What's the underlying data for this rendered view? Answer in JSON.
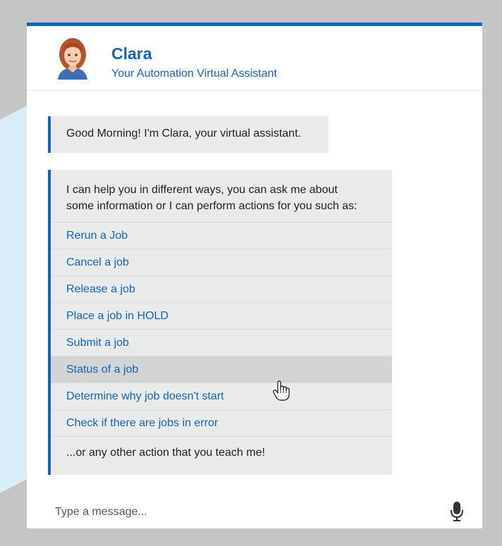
{
  "header": {
    "name": "Clara",
    "subtitle": "Your Automation Virtual Assistant"
  },
  "messages": {
    "greeting": "Good Morning! I'm Clara, your virtual assistant.",
    "intro_line1": "I can help you in different ways, you can ask me about",
    "intro_line2": "some information or I can perform actions for you such as:",
    "options": [
      "Rerun a Job",
      "Cancel a job",
      "Release a job",
      "Place a job in HOLD",
      "Submit a job",
      "Status of a job",
      "Determine why job doesn't start",
      "Check if there are jobs in error"
    ],
    "hovered_option": "Status of a job",
    "footer": "...or any other action that you teach me!"
  },
  "input": {
    "placeholder": "Type a message..."
  },
  "colors": {
    "accent": "#1565b7",
    "bubble": "#e9eaea",
    "hover": "#d3d4d4",
    "frame": "#c4c5c5"
  },
  "icons": {
    "avatar": "assistant-avatar",
    "cursor": "hand-pointer-icon",
    "mic": "microphone-icon"
  }
}
